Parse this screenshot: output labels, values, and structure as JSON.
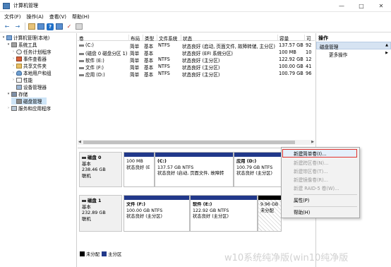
{
  "window": {
    "title": "计算机管理"
  },
  "menu": [
    "文件(F)",
    "操作(A)",
    "查看(V)",
    "帮助(H)"
  ],
  "tree": [
    {
      "label": "计算机管理(本地)",
      "depth": 0,
      "icon": "computer-icon"
    },
    {
      "label": "系统工具",
      "depth": 1,
      "icon": "tools-icon"
    },
    {
      "label": "任务计划程序",
      "depth": 2,
      "icon": "clock-icon"
    },
    {
      "label": "事件查看器",
      "depth": 2,
      "icon": "event-log-icon"
    },
    {
      "label": "共享文件夹",
      "depth": 2,
      "icon": "folder-icon"
    },
    {
      "label": "本地用户和组",
      "depth": 2,
      "icon": "users-icon"
    },
    {
      "label": "性能",
      "depth": 2,
      "icon": "performance-icon"
    },
    {
      "label": "设备管理器",
      "depth": 2,
      "icon": "device-manager-icon"
    },
    {
      "label": "存储",
      "depth": 1,
      "icon": "storage-icon"
    },
    {
      "label": "磁盘管理",
      "depth": 2,
      "icon": "disk-icon",
      "selected": true
    },
    {
      "label": "服务和应用程序",
      "depth": 1,
      "icon": "services-icon"
    }
  ],
  "volumes": {
    "columns": [
      "卷",
      "布局",
      "类型",
      "文件系统",
      "状态",
      "容量",
      "可"
    ],
    "rows": [
      [
        "(C:)",
        "简单",
        "基本",
        "NTFS",
        "状态良好 (启动, 页面文件, 故障转储, 主分区)",
        "137.57 GB",
        "92"
      ],
      [
        "(磁盘 0 磁盘分区 1)",
        "简单",
        "基本",
        "",
        "状态良好 (EFI 系统分区)",
        "100 MB",
        "10"
      ],
      [
        "软件 (E:)",
        "简单",
        "基本",
        "NTFS",
        "状态良好 (主分区)",
        "122.92 GB",
        "12"
      ],
      [
        "文件 (F:)",
        "简单",
        "基本",
        "NTFS",
        "状态良好 (主分区)",
        "100.00 GB",
        "41"
      ],
      [
        "应用 (D:)",
        "简单",
        "基本",
        "NTFS",
        "状态良好 (主分区)",
        "100.79 GB",
        "96"
      ]
    ]
  },
  "disks": [
    {
      "name": "磁盘 0",
      "type": "基本",
      "size": "238.46 GB",
      "status": "联机",
      "partitions": [
        {
          "name": "",
          "size": "100 MB",
          "status": "状态良好 (E"
        },
        {
          "name": "(C:)",
          "size": "137.57 GB NTFS",
          "status": "状态良好 (启动, 页面文件, 故障转"
        },
        {
          "name": "应用 (D:)",
          "size": "100.79 GB NTFS",
          "status": "状态良好 (主分区)"
        }
      ]
    },
    {
      "name": "磁盘 1",
      "type": "基本",
      "size": "232.89 GB",
      "status": "联机",
      "partitions": [
        {
          "name": "文件 (F:)",
          "size": "100.00 GB NTFS",
          "status": "状态良好 (主分区)"
        },
        {
          "name": "软件 (E:)",
          "size": "122.92 GB NTFS",
          "status": "状态良好 (主分区)"
        },
        {
          "name": "",
          "size": "9.96 GB",
          "status": "未分配"
        }
      ]
    }
  ],
  "legend": [
    {
      "label": "未分配",
      "color": "#000000"
    },
    {
      "label": "主分区",
      "color": "#21388a"
    }
  ],
  "actions": {
    "header": "操作",
    "section": "磁盘管理",
    "items": [
      "更多操作"
    ]
  },
  "context_menu": [
    {
      "label": "新建简单卷(I)...",
      "enabled": true,
      "highlighted": true
    },
    {
      "label": "新建跨区卷(N)...",
      "enabled": false
    },
    {
      "label": "新建带区卷(T)...",
      "enabled": false
    },
    {
      "label": "新建镜像卷(R)...",
      "enabled": false
    },
    {
      "label": "新建 RAID-5 卷(W)...",
      "enabled": false
    },
    {
      "label": "属性(P)",
      "enabled": true
    },
    {
      "label": "帮助(H)",
      "enabled": true
    }
  ],
  "watermark": "w10系统纯净版(win10纯净版"
}
